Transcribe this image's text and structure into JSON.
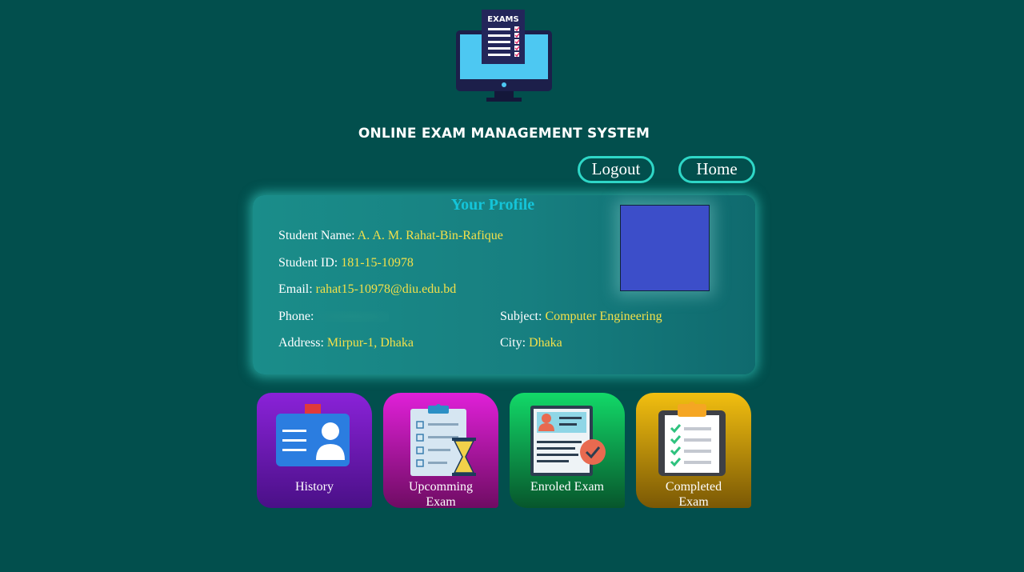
{
  "header": {
    "logo_icon": "exams-monitor-icon",
    "logo_text": "EXAMS",
    "title": "ONLINE EXAM MANAGEMENT SYSTEM"
  },
  "nav": {
    "logout_label": "Logout",
    "home_label": "Home"
  },
  "profile": {
    "title": "Your Profile",
    "name_label": "Student Name:",
    "name_value": "A. A. M. Rahat-Bin-Rafique",
    "id_label": "Student ID:",
    "id_value": "181-15-10978",
    "email_label": "Email:",
    "email_value": "rahat15-10978@diu.edu.bd",
    "phone_label": "Phone:",
    "subject_label": "Subject:",
    "subject_value": "Computer Engineering",
    "address_label": "Address:",
    "address_value": "Mirpur-1, Dhaka",
    "city_label": "City:",
    "city_value": "Dhaka"
  },
  "tiles": [
    {
      "label": "History",
      "icon": "id-card-icon"
    },
    {
      "label": "Upcomming Exam",
      "icon": "clipboard-hourglass-icon"
    },
    {
      "label": "Enroled Exam",
      "icon": "profile-document-check-icon"
    },
    {
      "label": "Completed Exam",
      "icon": "clipboard-checklist-icon"
    }
  ],
  "colors": {
    "background": "#024f4d",
    "accent": "#2fd7c7",
    "value_text": "#f2e04a",
    "profile_title": "#14c4d8"
  }
}
